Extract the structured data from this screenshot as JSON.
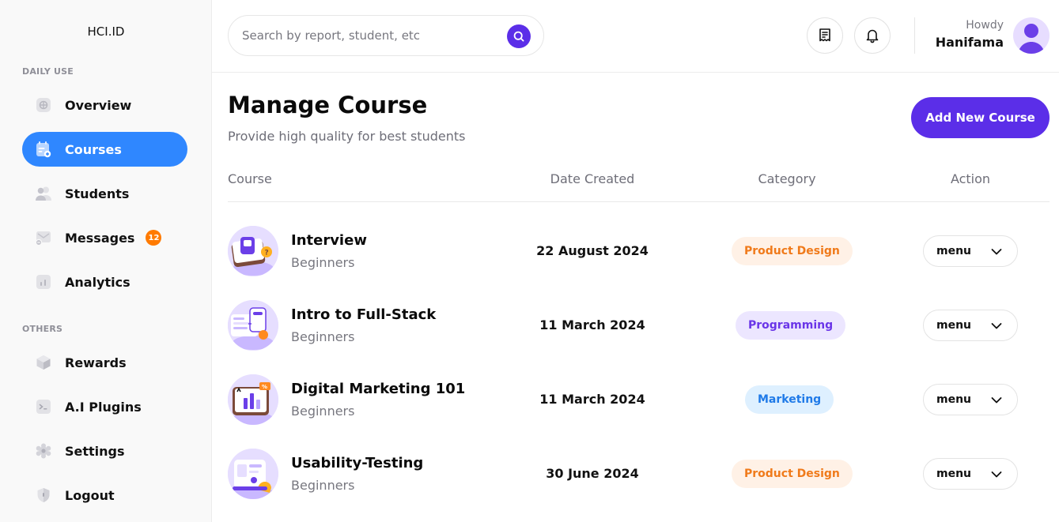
{
  "brand": "HCI.ID",
  "sidebar": {
    "sections": [
      {
        "label": "DAILY USE"
      },
      {
        "label": "OTHERS"
      }
    ],
    "items": [
      {
        "label": "Overview",
        "icon": "overview-icon"
      },
      {
        "label": "Courses",
        "icon": "courses-icon",
        "active": true
      },
      {
        "label": "Students",
        "icon": "students-icon"
      },
      {
        "label": "Messages",
        "icon": "messages-icon",
        "badge": "12"
      },
      {
        "label": "Analytics",
        "icon": "analytics-icon"
      },
      {
        "label": "Rewards",
        "icon": "rewards-icon"
      },
      {
        "label": "A.I Plugins",
        "icon": "terminal-icon"
      },
      {
        "label": "Settings",
        "icon": "gear-icon"
      },
      {
        "label": "Logout",
        "icon": "shield-icon"
      }
    ]
  },
  "search": {
    "placeholder": "Search by report, student, etc",
    "value": ""
  },
  "user": {
    "greeting": "Howdy",
    "name": "Hanifama"
  },
  "page": {
    "title": "Manage Course",
    "subtitle": "Provide high quality for best students",
    "add_button": "Add New Course"
  },
  "table": {
    "headers": [
      "Course",
      "Date Created",
      "Category",
      "Action"
    ],
    "rows": [
      {
        "title": "Interview",
        "level": "Beginners",
        "date": "22 August 2024",
        "category": "Product Design",
        "action": "menu"
      },
      {
        "title": "Intro to Full-Stack",
        "level": "Beginners",
        "date": "11 March 2024",
        "category": "Programming",
        "action": "menu"
      },
      {
        "title": "Digital Marketing 101",
        "level": "Beginners",
        "date": "11 March 2024",
        "category": "Marketing",
        "action": "menu"
      },
      {
        "title": "Usability-Testing",
        "level": "Beginners",
        "date": "30 June 2024",
        "category": "Product Design",
        "action": "menu"
      }
    ]
  },
  "colors": {
    "accent": "#5b2ee8",
    "active_nav": "#2f87ff",
    "badge": "#ff7a00",
    "product_design_bg": "#fff1e6",
    "product_design_fg": "#f07a1a",
    "programming_bg": "#ece6ff",
    "programming_fg": "#6a35e8",
    "marketing_bg": "#def0ff",
    "marketing_fg": "#1f7ae8"
  }
}
